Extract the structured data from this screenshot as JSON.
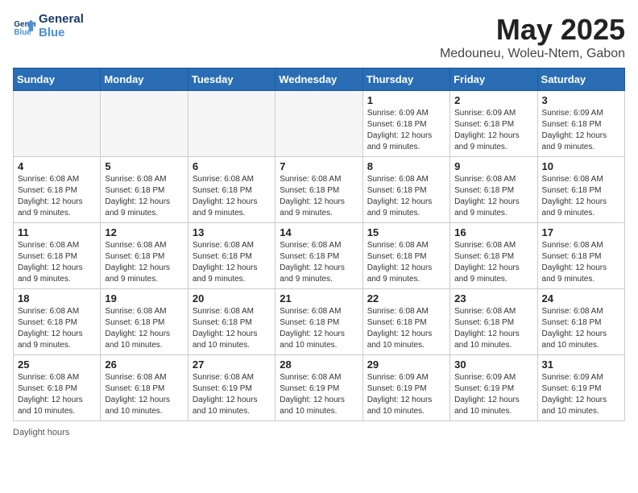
{
  "logo": {
    "line1": "General",
    "line2": "Blue"
  },
  "title": "May 2025",
  "location": "Medouneu, Woleu-Ntem, Gabon",
  "days_of_week": [
    "Sunday",
    "Monday",
    "Tuesday",
    "Wednesday",
    "Thursday",
    "Friday",
    "Saturday"
  ],
  "footer": "Daylight hours",
  "weeks": [
    [
      {
        "day": "",
        "info": ""
      },
      {
        "day": "",
        "info": ""
      },
      {
        "day": "",
        "info": ""
      },
      {
        "day": "",
        "info": ""
      },
      {
        "day": "1",
        "info": "Sunrise: 6:09 AM\nSunset: 6:18 PM\nDaylight: 12 hours and 9 minutes."
      },
      {
        "day": "2",
        "info": "Sunrise: 6:09 AM\nSunset: 6:18 PM\nDaylight: 12 hours and 9 minutes."
      },
      {
        "day": "3",
        "info": "Sunrise: 6:09 AM\nSunset: 6:18 PM\nDaylight: 12 hours and 9 minutes."
      }
    ],
    [
      {
        "day": "4",
        "info": "Sunrise: 6:08 AM\nSunset: 6:18 PM\nDaylight: 12 hours and 9 minutes."
      },
      {
        "day": "5",
        "info": "Sunrise: 6:08 AM\nSunset: 6:18 PM\nDaylight: 12 hours and 9 minutes."
      },
      {
        "day": "6",
        "info": "Sunrise: 6:08 AM\nSunset: 6:18 PM\nDaylight: 12 hours and 9 minutes."
      },
      {
        "day": "7",
        "info": "Sunrise: 6:08 AM\nSunset: 6:18 PM\nDaylight: 12 hours and 9 minutes."
      },
      {
        "day": "8",
        "info": "Sunrise: 6:08 AM\nSunset: 6:18 PM\nDaylight: 12 hours and 9 minutes."
      },
      {
        "day": "9",
        "info": "Sunrise: 6:08 AM\nSunset: 6:18 PM\nDaylight: 12 hours and 9 minutes."
      },
      {
        "day": "10",
        "info": "Sunrise: 6:08 AM\nSunset: 6:18 PM\nDaylight: 12 hours and 9 minutes."
      }
    ],
    [
      {
        "day": "11",
        "info": "Sunrise: 6:08 AM\nSunset: 6:18 PM\nDaylight: 12 hours and 9 minutes."
      },
      {
        "day": "12",
        "info": "Sunrise: 6:08 AM\nSunset: 6:18 PM\nDaylight: 12 hours and 9 minutes."
      },
      {
        "day": "13",
        "info": "Sunrise: 6:08 AM\nSunset: 6:18 PM\nDaylight: 12 hours and 9 minutes."
      },
      {
        "day": "14",
        "info": "Sunrise: 6:08 AM\nSunset: 6:18 PM\nDaylight: 12 hours and 9 minutes."
      },
      {
        "day": "15",
        "info": "Sunrise: 6:08 AM\nSunset: 6:18 PM\nDaylight: 12 hours and 9 minutes."
      },
      {
        "day": "16",
        "info": "Sunrise: 6:08 AM\nSunset: 6:18 PM\nDaylight: 12 hours and 9 minutes."
      },
      {
        "day": "17",
        "info": "Sunrise: 6:08 AM\nSunset: 6:18 PM\nDaylight: 12 hours and 9 minutes."
      }
    ],
    [
      {
        "day": "18",
        "info": "Sunrise: 6:08 AM\nSunset: 6:18 PM\nDaylight: 12 hours and 9 minutes."
      },
      {
        "day": "19",
        "info": "Sunrise: 6:08 AM\nSunset: 6:18 PM\nDaylight: 12 hours and 10 minutes."
      },
      {
        "day": "20",
        "info": "Sunrise: 6:08 AM\nSunset: 6:18 PM\nDaylight: 12 hours and 10 minutes."
      },
      {
        "day": "21",
        "info": "Sunrise: 6:08 AM\nSunset: 6:18 PM\nDaylight: 12 hours and 10 minutes."
      },
      {
        "day": "22",
        "info": "Sunrise: 6:08 AM\nSunset: 6:18 PM\nDaylight: 12 hours and 10 minutes."
      },
      {
        "day": "23",
        "info": "Sunrise: 6:08 AM\nSunset: 6:18 PM\nDaylight: 12 hours and 10 minutes."
      },
      {
        "day": "24",
        "info": "Sunrise: 6:08 AM\nSunset: 6:18 PM\nDaylight: 12 hours and 10 minutes."
      }
    ],
    [
      {
        "day": "25",
        "info": "Sunrise: 6:08 AM\nSunset: 6:18 PM\nDaylight: 12 hours and 10 minutes."
      },
      {
        "day": "26",
        "info": "Sunrise: 6:08 AM\nSunset: 6:18 PM\nDaylight: 12 hours and 10 minutes."
      },
      {
        "day": "27",
        "info": "Sunrise: 6:08 AM\nSunset: 6:19 PM\nDaylight: 12 hours and 10 minutes."
      },
      {
        "day": "28",
        "info": "Sunrise: 6:08 AM\nSunset: 6:19 PM\nDaylight: 12 hours and 10 minutes."
      },
      {
        "day": "29",
        "info": "Sunrise: 6:09 AM\nSunset: 6:19 PM\nDaylight: 12 hours and 10 minutes."
      },
      {
        "day": "30",
        "info": "Sunrise: 6:09 AM\nSunset: 6:19 PM\nDaylight: 12 hours and 10 minutes."
      },
      {
        "day": "31",
        "info": "Sunrise: 6:09 AM\nSunset: 6:19 PM\nDaylight: 12 hours and 10 minutes."
      }
    ]
  ]
}
